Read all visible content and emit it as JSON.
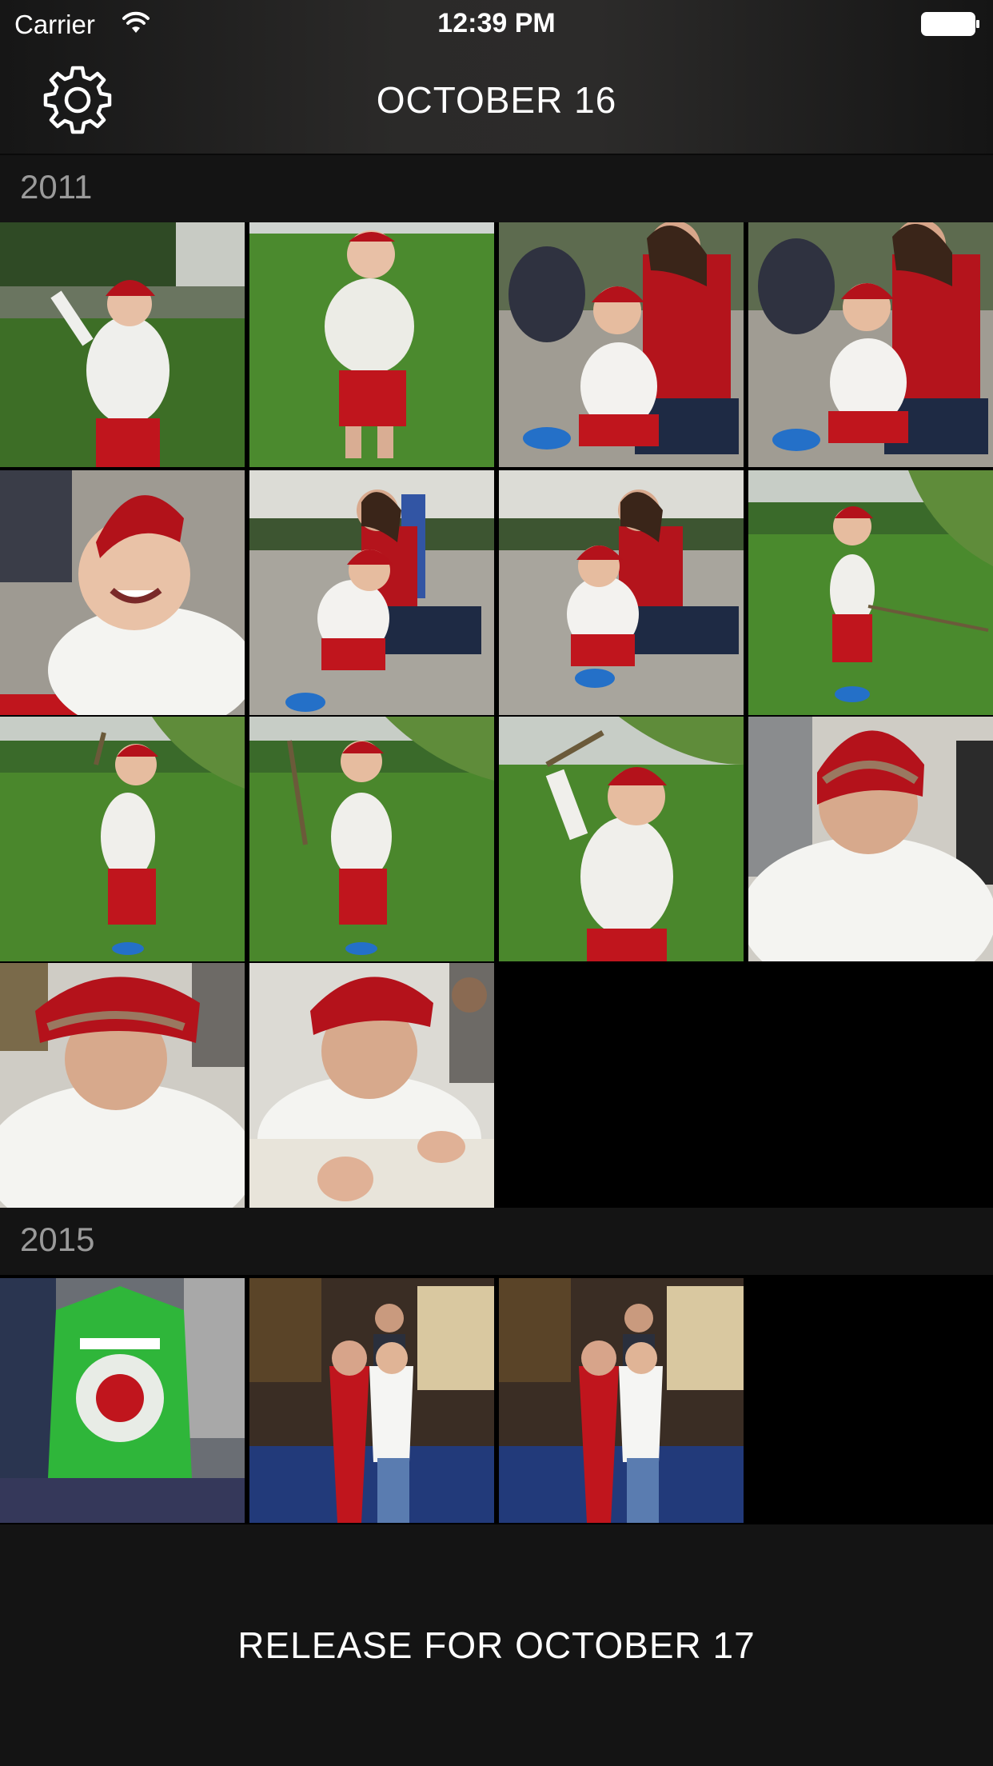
{
  "status_bar": {
    "carrier": "Carrier",
    "time": "12:39 PM",
    "wifi_icon": "wifi-icon",
    "battery_icon": "battery-full-icon"
  },
  "nav": {
    "title": "OCTOBER 16",
    "settings_icon": "gear-icon"
  },
  "sections": [
    {
      "year": "2011",
      "photos": [
        {
          "subject": "toddler-red-cap-grass"
        },
        {
          "subject": "toddler-walking-grass"
        },
        {
          "subject": "toddler-woman-skatepark"
        },
        {
          "subject": "toddler-woman-skatepark"
        },
        {
          "subject": "toddler-laughing-closeup"
        },
        {
          "subject": "toddler-woman-skatepark"
        },
        {
          "subject": "toddler-woman-skatepark"
        },
        {
          "subject": "toddler-willow-tree"
        },
        {
          "subject": "toddler-stick-park"
        },
        {
          "subject": "toddler-stick-park"
        },
        {
          "subject": "toddler-stick-raised"
        },
        {
          "subject": "toddler-drawing-table"
        },
        {
          "subject": "toddler-drawing-table"
        },
        {
          "subject": "toddler-drawing-table"
        }
      ]
    },
    {
      "year": "2015",
      "photos": [
        {
          "subject": "green-hoodie-store"
        },
        {
          "subject": "two-women-man-hall"
        },
        {
          "subject": "two-women-man-hall"
        }
      ]
    }
  ],
  "footer": {
    "release_label": "RELEASE FOR OCTOBER 17"
  },
  "colors": {
    "background": "#000000",
    "header": "#2b2a29",
    "section_header": "#141414",
    "year_text": "#9a9a9a",
    "accent_red": "#c0151d",
    "grass": "#3f7f2a"
  }
}
